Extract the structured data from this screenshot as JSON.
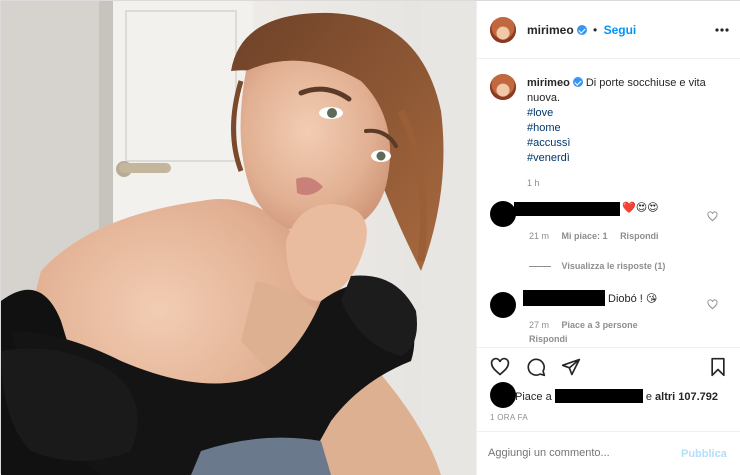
{
  "post": {
    "username": "mirimeo",
    "dot": "•",
    "follow_label": "Segui",
    "more_icon": "more-horizontal-icon"
  },
  "caption": {
    "username": "mirimeo",
    "text": "Di porte socchiuse e vita nuova.",
    "hashtags": [
      "#love",
      "#home",
      "#accussì",
      "#venerdì"
    ],
    "time": "1 h"
  },
  "comments": [
    {
      "emojis": "❤️😍😍",
      "time": "21 m",
      "likes": "Mi piace: 1",
      "reply_label": "Rispondi",
      "view_replies": "Visualizza le risposte (1)"
    },
    {
      "text": "Diobó !",
      "emoji": "😘",
      "time": "27 m",
      "likes": "Piace a 3 persone",
      "reply_label": "Rispondi"
    }
  ],
  "likes": {
    "prefix": "Piace a",
    "suffix": "e",
    "others": "altri 107.792"
  },
  "timestamp": "1 ORA FA",
  "add_comment": {
    "placeholder": "Aggiungi un commento...",
    "publish_label": "Pubblica"
  },
  "colors": {
    "accent": "#0095f6",
    "hashtag": "#00376b",
    "heart_red": "#ed4956"
  }
}
